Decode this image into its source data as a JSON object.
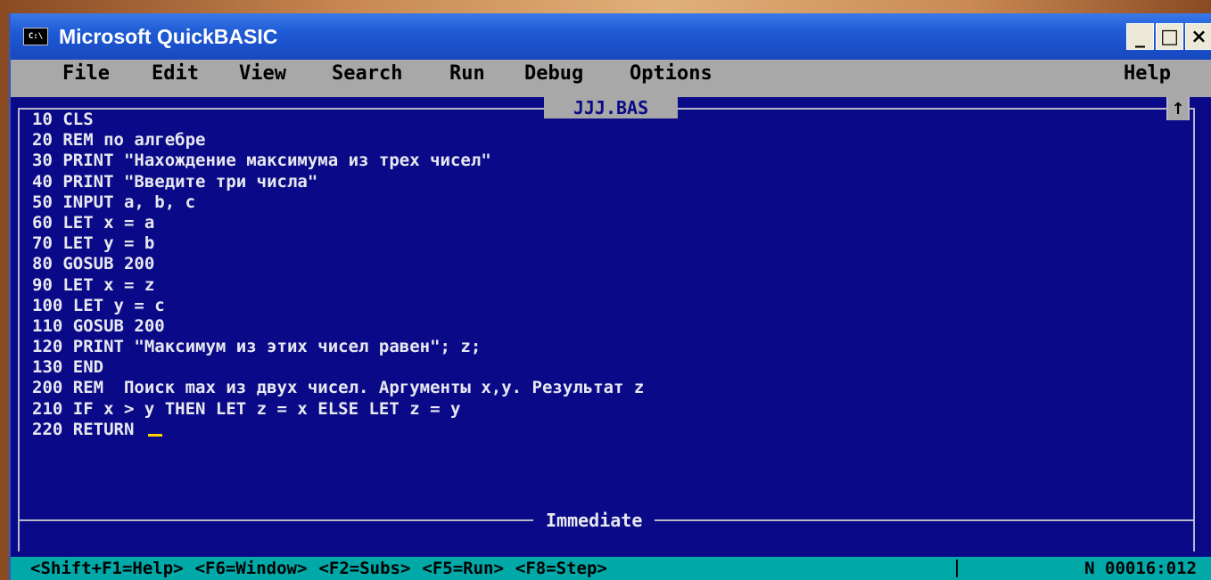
{
  "window": {
    "title": "Microsoft QuickBASIC",
    "sys_icon_text": "C:\\",
    "minimize": "_",
    "maximize": "□",
    "close": "×"
  },
  "menu": {
    "items": [
      "File",
      "Edit",
      "View",
      "Search",
      "Run",
      "Debug",
      "Options"
    ],
    "help": "Help"
  },
  "editor": {
    "filename": "JJJ.BAS",
    "scroll_up": "↑",
    "lines": [
      "10 CLS",
      "20 REM по алгебре",
      "30 PRINT \"Нахождение максимума из трех чисел\"",
      "40 PRINT \"Введите три числа\"",
      "50 INPUT a, b, c",
      "60 LET x = a",
      "70 LET y = b",
      "80 GOSUB 200",
      "90 LET x = z",
      "100 LET y = c",
      "110 GOSUB 200",
      "120 PRINT \"Максимум из этих чисел равен\"; z;",
      "130 END",
      "200 REM  Поиск max из двух чисел. Аргументы x,y. Результат z",
      "210 IF x > y THEN LET z = x ELSE LET z = y",
      "220 RETURN "
    ]
  },
  "immediate": {
    "label": "Immediate"
  },
  "status": {
    "items": [
      "<Shift+F1=Help>",
      "<F6=Window>",
      "<F2=Subs>",
      "<F5=Run>",
      "<F8=Step>"
    ],
    "position": "N 00016:012"
  }
}
